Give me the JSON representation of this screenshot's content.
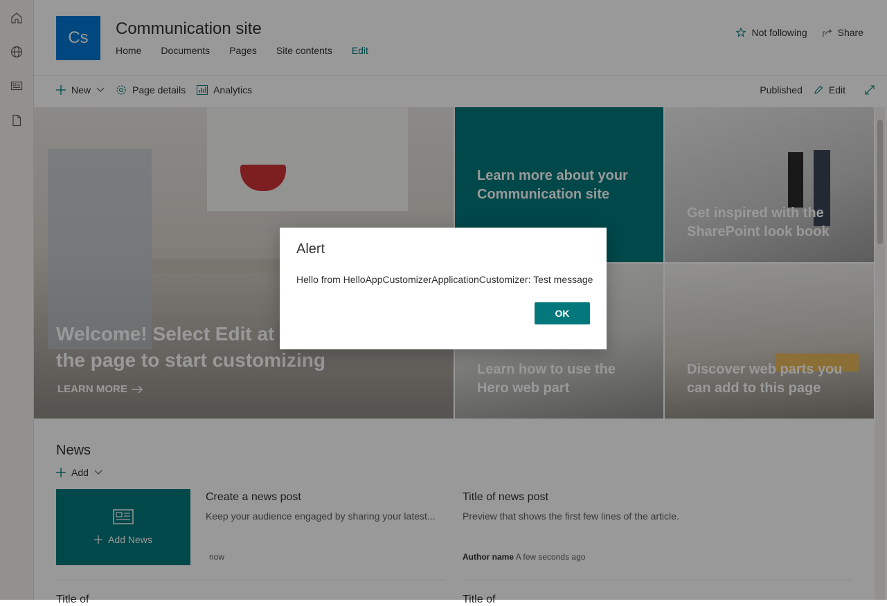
{
  "site": {
    "logo_text": "Cs",
    "title": "Communication site",
    "nav": [
      "Home",
      "Documents",
      "Pages",
      "Site contents",
      "Edit"
    ],
    "not_following": "Not following",
    "share": "Share"
  },
  "commands": {
    "new": "New",
    "page_details": "Page details",
    "analytics": "Analytics",
    "published": "Published",
    "edit": "Edit"
  },
  "hero": {
    "main_title": "Welcome! Select Edit at the top of the page to start customizing",
    "learn_more": "LEARN MORE",
    "tile1": "Learn more about your Communication site",
    "tile2": "Get inspired with the SharePoint look book",
    "tile3": "Learn how to use the Hero web part",
    "tile4": "Discover web parts you can add to this page"
  },
  "news": {
    "title": "News",
    "add": "Add",
    "add_news": "Add News",
    "create_title": "Create a news post",
    "create_desc": "Keep your audience engaged by sharing your latest...",
    "create_meta": "now",
    "post_title": "Title of news post",
    "post_desc": "Preview that shows the first few lines of the article.",
    "author": "Author name",
    "post_meta": "A few seconds ago",
    "partial_left": "Title of",
    "partial_right": "Title of"
  },
  "dialog": {
    "title": "Alert",
    "message": "Hello from HelloAppCustomizerApplicationCustomizer: Test message",
    "ok": "OK"
  },
  "colors": {
    "brand": "#0078d4",
    "accent": "#03787c"
  }
}
